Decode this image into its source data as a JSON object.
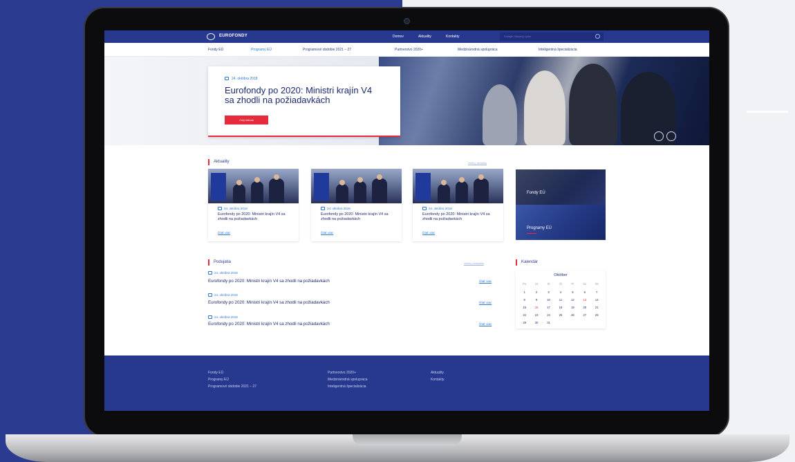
{
  "site": {
    "brand": "EUROFONDY",
    "top_nav": [
      "Domov",
      "Aktuality",
      "Kontakty"
    ],
    "search_placeholder": "Zadajte hľadaný výraz"
  },
  "secondary_nav": {
    "items": [
      "Fondy EÚ",
      "Programy EÚ",
      "Programové obdobie 2021 – 27",
      "Partnerstvo 2020+",
      "Medzinárodná spolupráca",
      "Inteligentná špecializácia"
    ],
    "active_index": 1
  },
  "hero": {
    "date": "24. októbra 2018",
    "title": "Eurofondy po 2020: Ministri krajín V4 sa zhodli na požiadavkách",
    "button": "Celý článok"
  },
  "news": {
    "heading": "Aktuality",
    "all_link": "všetky aktuality",
    "items": [
      {
        "date": "24. októbra 2018",
        "title": "Eurofondy po 2020: Ministri krajín V4 sa zhodli na požiadavkách",
        "more": "čítať viac"
      },
      {
        "date": "24. októbra 2018",
        "title": "Eurofondy po 2020: Ministri krajín V4 sa zhodli na požiadavkách",
        "more": "čítať viac"
      },
      {
        "date": "24. októbra 2018",
        "title": "Eurofondy po 2020: Ministri krajín V4 sa zhodli na požiadavkách",
        "more": "čítať viac"
      }
    ]
  },
  "tiles": [
    "Fondy EÚ",
    "Programy EÚ"
  ],
  "events": {
    "heading": "Podujatia",
    "all_link": "všetky podujatia",
    "items": [
      {
        "date": "24. októbra 2018",
        "title": "Eurofondy po 2020: Ministri krajín V4 sa zhodli na požiadavkách",
        "more": "čítať viac"
      },
      {
        "date": "24. októbra 2018",
        "title": "Eurofondy po 2020: Ministri krajín V4 sa zhodli na požiadavkách",
        "more": "čítať viac"
      },
      {
        "date": "24. októbra 2018",
        "title": "Eurofondy po 2020: Ministri krajín V4 sa zhodli na požiadavkách",
        "more": "čítať viac"
      }
    ]
  },
  "calendar": {
    "heading": "Kalendár",
    "month": "Október",
    "weekdays": [
      "Po",
      "Ut",
      "St",
      "Št",
      "Pi",
      "So",
      "Ne"
    ],
    "weeks": [
      [
        "1",
        "2",
        "3",
        "4",
        "5",
        "6",
        "7"
      ],
      [
        "8",
        "9",
        "10",
        "11",
        "12",
        "13",
        "14"
      ],
      [
        "15",
        "16",
        "17",
        "18",
        "19",
        "20",
        "21"
      ],
      [
        "22",
        "23",
        "24",
        "25",
        "26",
        "27",
        "28"
      ],
      [
        "29",
        "30",
        "31",
        "",
        "",
        "",
        ""
      ]
    ],
    "highlighted": [
      "13",
      "16"
    ]
  },
  "footer": {
    "columns": [
      [
        "Fondy EÚ",
        "Programy EÚ",
        "Programové obdobie 2021 – 27"
      ],
      [
        "Partnerstvo 2020+",
        "Medzinárodná spolupráca",
        "Inteligentná špecializácia"
      ],
      [
        "Aktuality",
        "Kontakty"
      ]
    ]
  },
  "colors": {
    "brand_blue": "#27388f",
    "accent_red": "#e52b3c",
    "link_blue": "#2a78d6"
  }
}
